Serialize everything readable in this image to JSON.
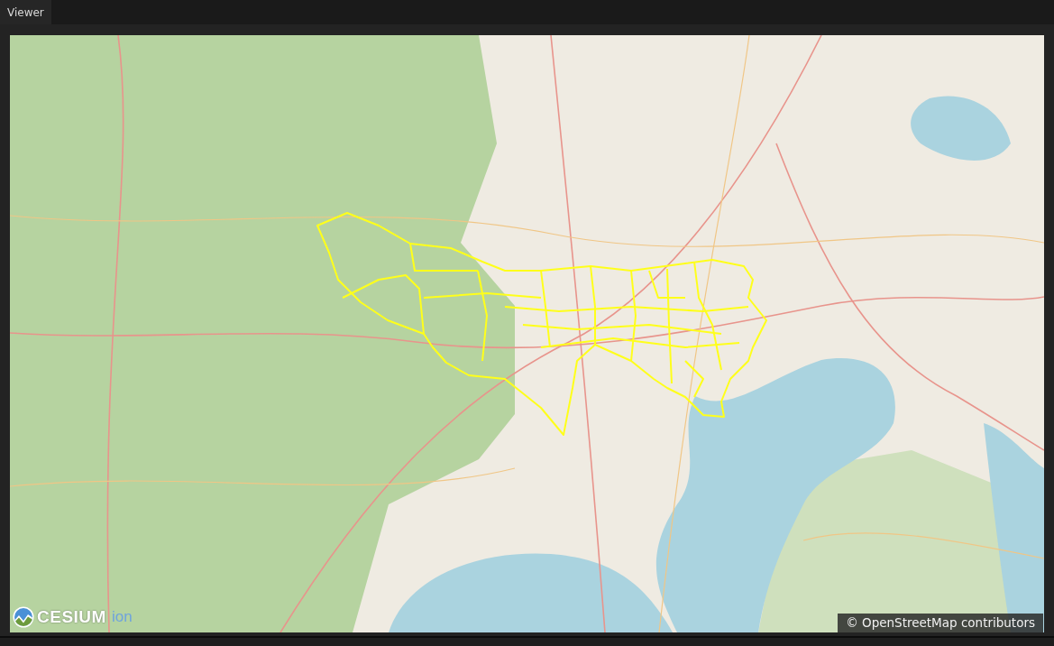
{
  "tabs": [
    {
      "label": "Viewer",
      "selected": true
    }
  ],
  "map": {
    "logo": {
      "wordmark": "CESIUM",
      "suffix": "ion"
    },
    "attribution": "© OpenStreetMap contributors"
  }
}
